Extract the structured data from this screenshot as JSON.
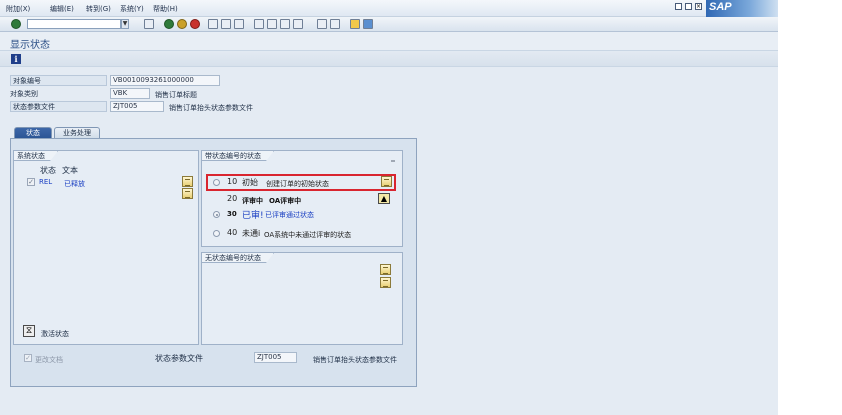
{
  "menu": [
    "附加(X)",
    "编辑(E)",
    "转到(G)",
    "系统(Y)",
    "帮助(H)"
  ],
  "brand": "SAP",
  "page_title": "显示状态",
  "header": {
    "object_no_label": "对象编号",
    "object_no_value": "VB0010093261000000",
    "object_type_label": "对象类别",
    "object_type_value": "VBK",
    "object_type_desc": "销售订单标题",
    "status_profile_label": "状态参数文件",
    "status_profile_value": "ZJT005",
    "status_profile_desc": "销售订单抬头状态参数文件"
  },
  "tabs": [
    {
      "label": "状态",
      "active": true
    },
    {
      "label": "业务处理",
      "active": false
    }
  ],
  "system_status": {
    "title": "系统状态",
    "col_status": "状态",
    "col_text": "文本",
    "rows": [
      {
        "checked": true,
        "code": "REL",
        "text": "已释放"
      }
    ],
    "activate_label": "激活状态"
  },
  "user_status_numbered": {
    "title": "带状态编号的状态",
    "rows": [
      {
        "selected": false,
        "number": "10",
        "short": "初始",
        "text": "创建订单的初始状态"
      },
      {
        "selected": false,
        "number": "20",
        "short": "评审中",
        "text": "OA评审中"
      },
      {
        "selected": true,
        "number": "30",
        "short": "已审!",
        "text": "已评审通过状态"
      },
      {
        "selected": false,
        "number": "40",
        "short": "未通i",
        "text": "OA系统中未通过评审的状态"
      }
    ]
  },
  "user_status_unnumbered": {
    "title": "无状态编号的状态"
  },
  "footer": {
    "change_docs_label": "更改文档",
    "profile_label": "状态参数文件",
    "profile_value": "ZJT005",
    "profile_desc": "销售订单抬头状态参数文件"
  },
  "colors": {
    "tab_active": "#2a5393",
    "status_blue": "#1a3fc2",
    "highlight_red": "#d9252f"
  }
}
